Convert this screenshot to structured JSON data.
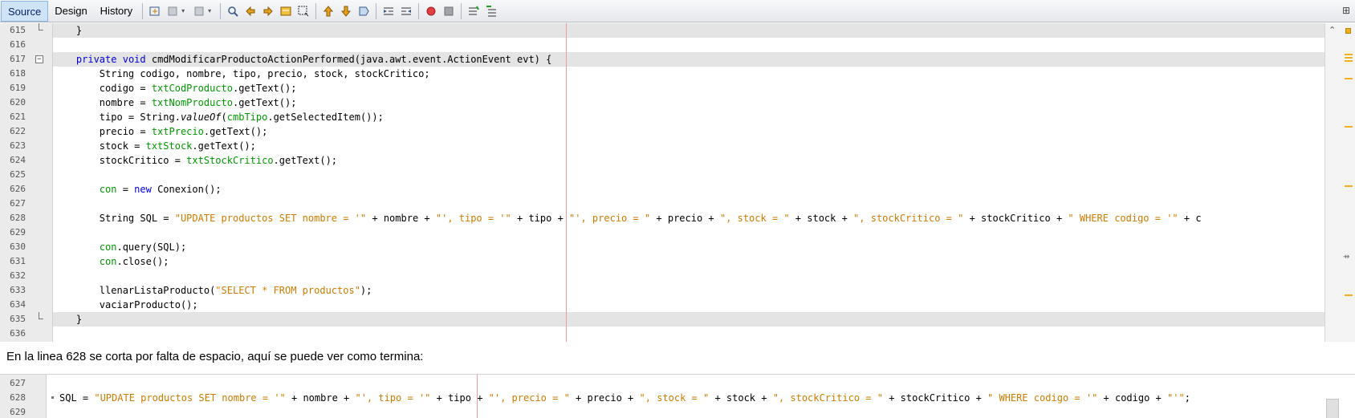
{
  "toolbar": {
    "tabs": [
      {
        "label": "Source",
        "active": true
      },
      {
        "label": "Design",
        "active": false
      },
      {
        "label": "History",
        "active": false
      }
    ],
    "icons": [
      "last-edit-icon",
      "back-icon",
      "forward-icon",
      "find-selection-icon",
      "find-previous-icon",
      "find-next-icon",
      "toggle-highlight-icon",
      "rectangular-selection-icon",
      "previous-bookmark-icon",
      "next-bookmark-icon",
      "toggle-bookmark-icon",
      "shift-left-icon",
      "shift-right-icon",
      "start-macro-icon",
      "stop-macro-icon",
      "comment-icon",
      "uncomment-icon"
    ]
  },
  "editor": {
    "lines": [
      {
        "n": "615",
        "hl": true,
        "foldend": true,
        "html": "    }"
      },
      {
        "n": "616",
        "html": ""
      },
      {
        "n": "617",
        "hl": true,
        "fold": true,
        "html": "    <span class='k'>private</span> <span class='k'>void</span> cmdModificarProductoActionPerformed(java.awt.event.ActionEvent evt) {"
      },
      {
        "n": "618",
        "html": "        String codigo, nombre, tipo, precio, stock, stockCritico;"
      },
      {
        "n": "619",
        "html": "        codigo = <span class='f'>txtCodProducto</span>.getText();"
      },
      {
        "n": "620",
        "html": "        nombre = <span class='f'>txtNomProducto</span>.getText();"
      },
      {
        "n": "621",
        "html": "        tipo = String.<span class='i'>valueOf</span>(<span class='f'>cmbTipo</span>.getSelectedItem());"
      },
      {
        "n": "622",
        "html": "        precio = <span class='f'>txtPrecio</span>.getText();"
      },
      {
        "n": "623",
        "html": "        stock = <span class='f'>txtStock</span>.getText();"
      },
      {
        "n": "624",
        "html": "        stockCritico = <span class='f'>txtStockCritico</span>.getText();"
      },
      {
        "n": "625",
        "html": ""
      },
      {
        "n": "626",
        "html": "        <span class='f'>con</span> = <span class='k'>new</span> Conexion();"
      },
      {
        "n": "627",
        "html": ""
      },
      {
        "n": "628",
        "html": "        String SQL = <span class='s'>\"UPDATE productos SET nombre = '\"</span> + nombre + <span class='s'>\"', tipo = '\"</span> + tipo + <span class='s'>\"', precio = \"</span> + precio + <span class='s'>\", stock = \"</span> + stock + <span class='s'>\", stockCritico = \"</span> + stockCritico + <span class='s'>\" WHERE codigo = '\"</span> + c"
      },
      {
        "n": "629",
        "html": ""
      },
      {
        "n": "630",
        "html": "        <span class='f'>con</span>.query(SQL);"
      },
      {
        "n": "631",
        "html": "        <span class='f'>con</span>.close();"
      },
      {
        "n": "632",
        "html": ""
      },
      {
        "n": "633",
        "html": "        llenarListaProducto(<span class='s'>\"SELECT * FROM productos\"</span>);"
      },
      {
        "n": "634",
        "html": "        vaciarProducto();"
      },
      {
        "n": "635",
        "hl": true,
        "foldend": true,
        "html": "    }"
      },
      {
        "n": "636",
        "html": ""
      }
    ]
  },
  "caption": "En la linea 628 se corta por falta de espacio, aquí se puede ver como termina:",
  "editor2": {
    "lines": [
      {
        "n": "627",
        "html": ""
      },
      {
        "n": "628",
        "dot": true,
        "html": "SQL = <span class='s'>\"UPDATE productos SET nombre = '\"</span> + nombre + <span class='s'>\"', tipo = '\"</span> + tipo + <span class='s'>\"', precio = \"</span> + precio + <span class='s'>\", stock = \"</span> + stock + <span class='s'>\", stockCritico = \"</span> + stockCritico + <span class='s'>\" WHERE codigo = '\"</span> + codigo + <span class='s'>\"'\"</span>;"
      },
      {
        "n": "629",
        "html": ""
      }
    ]
  }
}
